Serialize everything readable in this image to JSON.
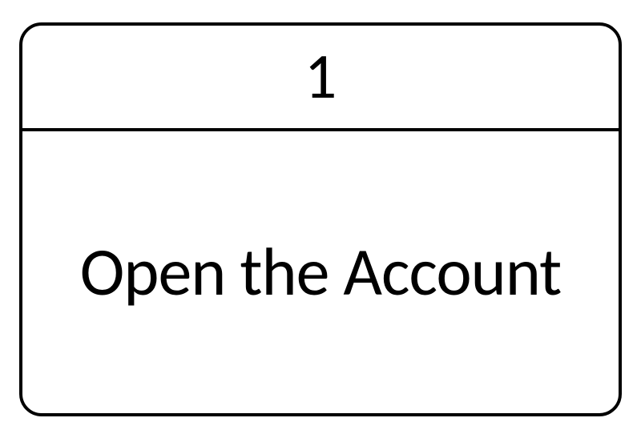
{
  "card": {
    "number": "1",
    "title": "Open the Account"
  }
}
